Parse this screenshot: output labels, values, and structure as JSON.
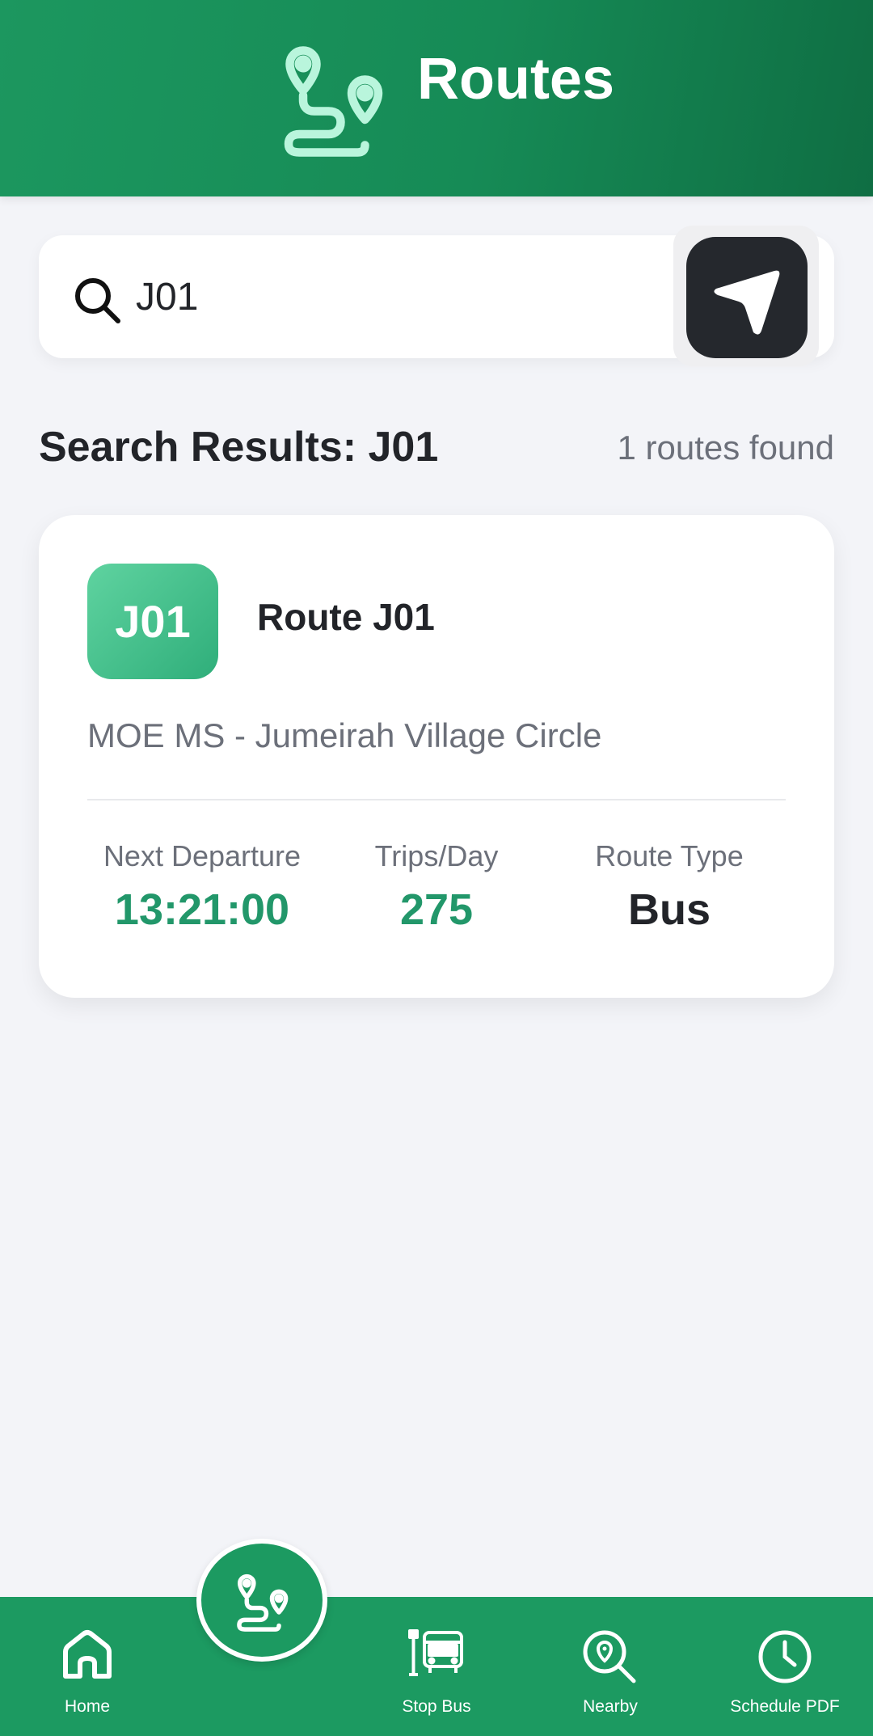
{
  "header": {
    "title": "Routes",
    "icon": "route-icon"
  },
  "search": {
    "value": "J01",
    "icon": "search-icon",
    "locate_icon": "navigation-arrow-icon"
  },
  "results": {
    "title": "Search Results: J01",
    "count_text": "1 routes found"
  },
  "routes": [
    {
      "badge": "J01",
      "name": "Route J01",
      "description": "MOE MS - Jumeirah Village Circle",
      "stats": [
        {
          "label": "Next Departure",
          "value": "13:21:00"
        },
        {
          "label": "Trips/Day",
          "value": "275"
        },
        {
          "label": "Route Type",
          "value": "Bus"
        }
      ]
    }
  ],
  "bottom_nav": {
    "items": [
      {
        "label": "Home",
        "icon": "home-icon"
      },
      {
        "label": "Stop Bus",
        "icon": "bus-stop-icon"
      },
      {
        "label": "Nearby",
        "icon": "nearby-search-icon"
      },
      {
        "label": "Schedule PDF",
        "icon": "clock-icon"
      }
    ],
    "center_button_icon": "route-icon"
  },
  "colors": {
    "primary": "#1c9a61",
    "header_dark": "#0f6e43",
    "badge": "#2fae7a",
    "value_green": "#22976a",
    "text_dark": "#222429",
    "text_muted": "#6c707a",
    "background": "#f3f4f8"
  }
}
